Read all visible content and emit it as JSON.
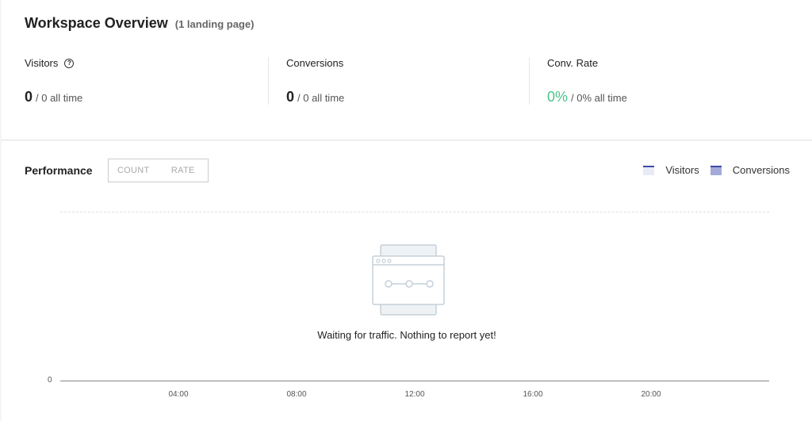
{
  "header": {
    "title": "Workspace Overview",
    "subtitle": "(1 landing page)"
  },
  "stats": [
    {
      "label": "Visitors",
      "value": "0",
      "all_time": "/ 0 all time",
      "help_icon": "question-circle-icon"
    },
    {
      "label": "Conversions",
      "value": "0",
      "all_time": "/ 0 all time"
    },
    {
      "label": "Conv. Rate",
      "value": "0%",
      "all_time": "/ 0% all time",
      "value_color": "#4cc38a"
    }
  ],
  "performance": {
    "title": "Performance",
    "toggle": [
      "COUNT",
      "RATE"
    ],
    "legend": [
      {
        "label": "Visitors",
        "color": "#e8ebf6",
        "stroke": "#3f4aa8"
      },
      {
        "label": "Conversions",
        "color": "#a3aad9",
        "stroke": "#3f4aa8"
      }
    ],
    "empty_message": "Waiting for traffic. Nothing to report yet!"
  },
  "chart_data": {
    "type": "area",
    "title": "Performance",
    "x": [],
    "series": [
      {
        "name": "Visitors",
        "values": []
      },
      {
        "name": "Conversions",
        "values": []
      }
    ],
    "y_ticks": [
      "0"
    ],
    "x_ticks": [
      "04:00",
      "08:00",
      "12:00",
      "16:00",
      "20:00"
    ],
    "xlabel": "",
    "ylabel": "",
    "legend": "top-right"
  }
}
